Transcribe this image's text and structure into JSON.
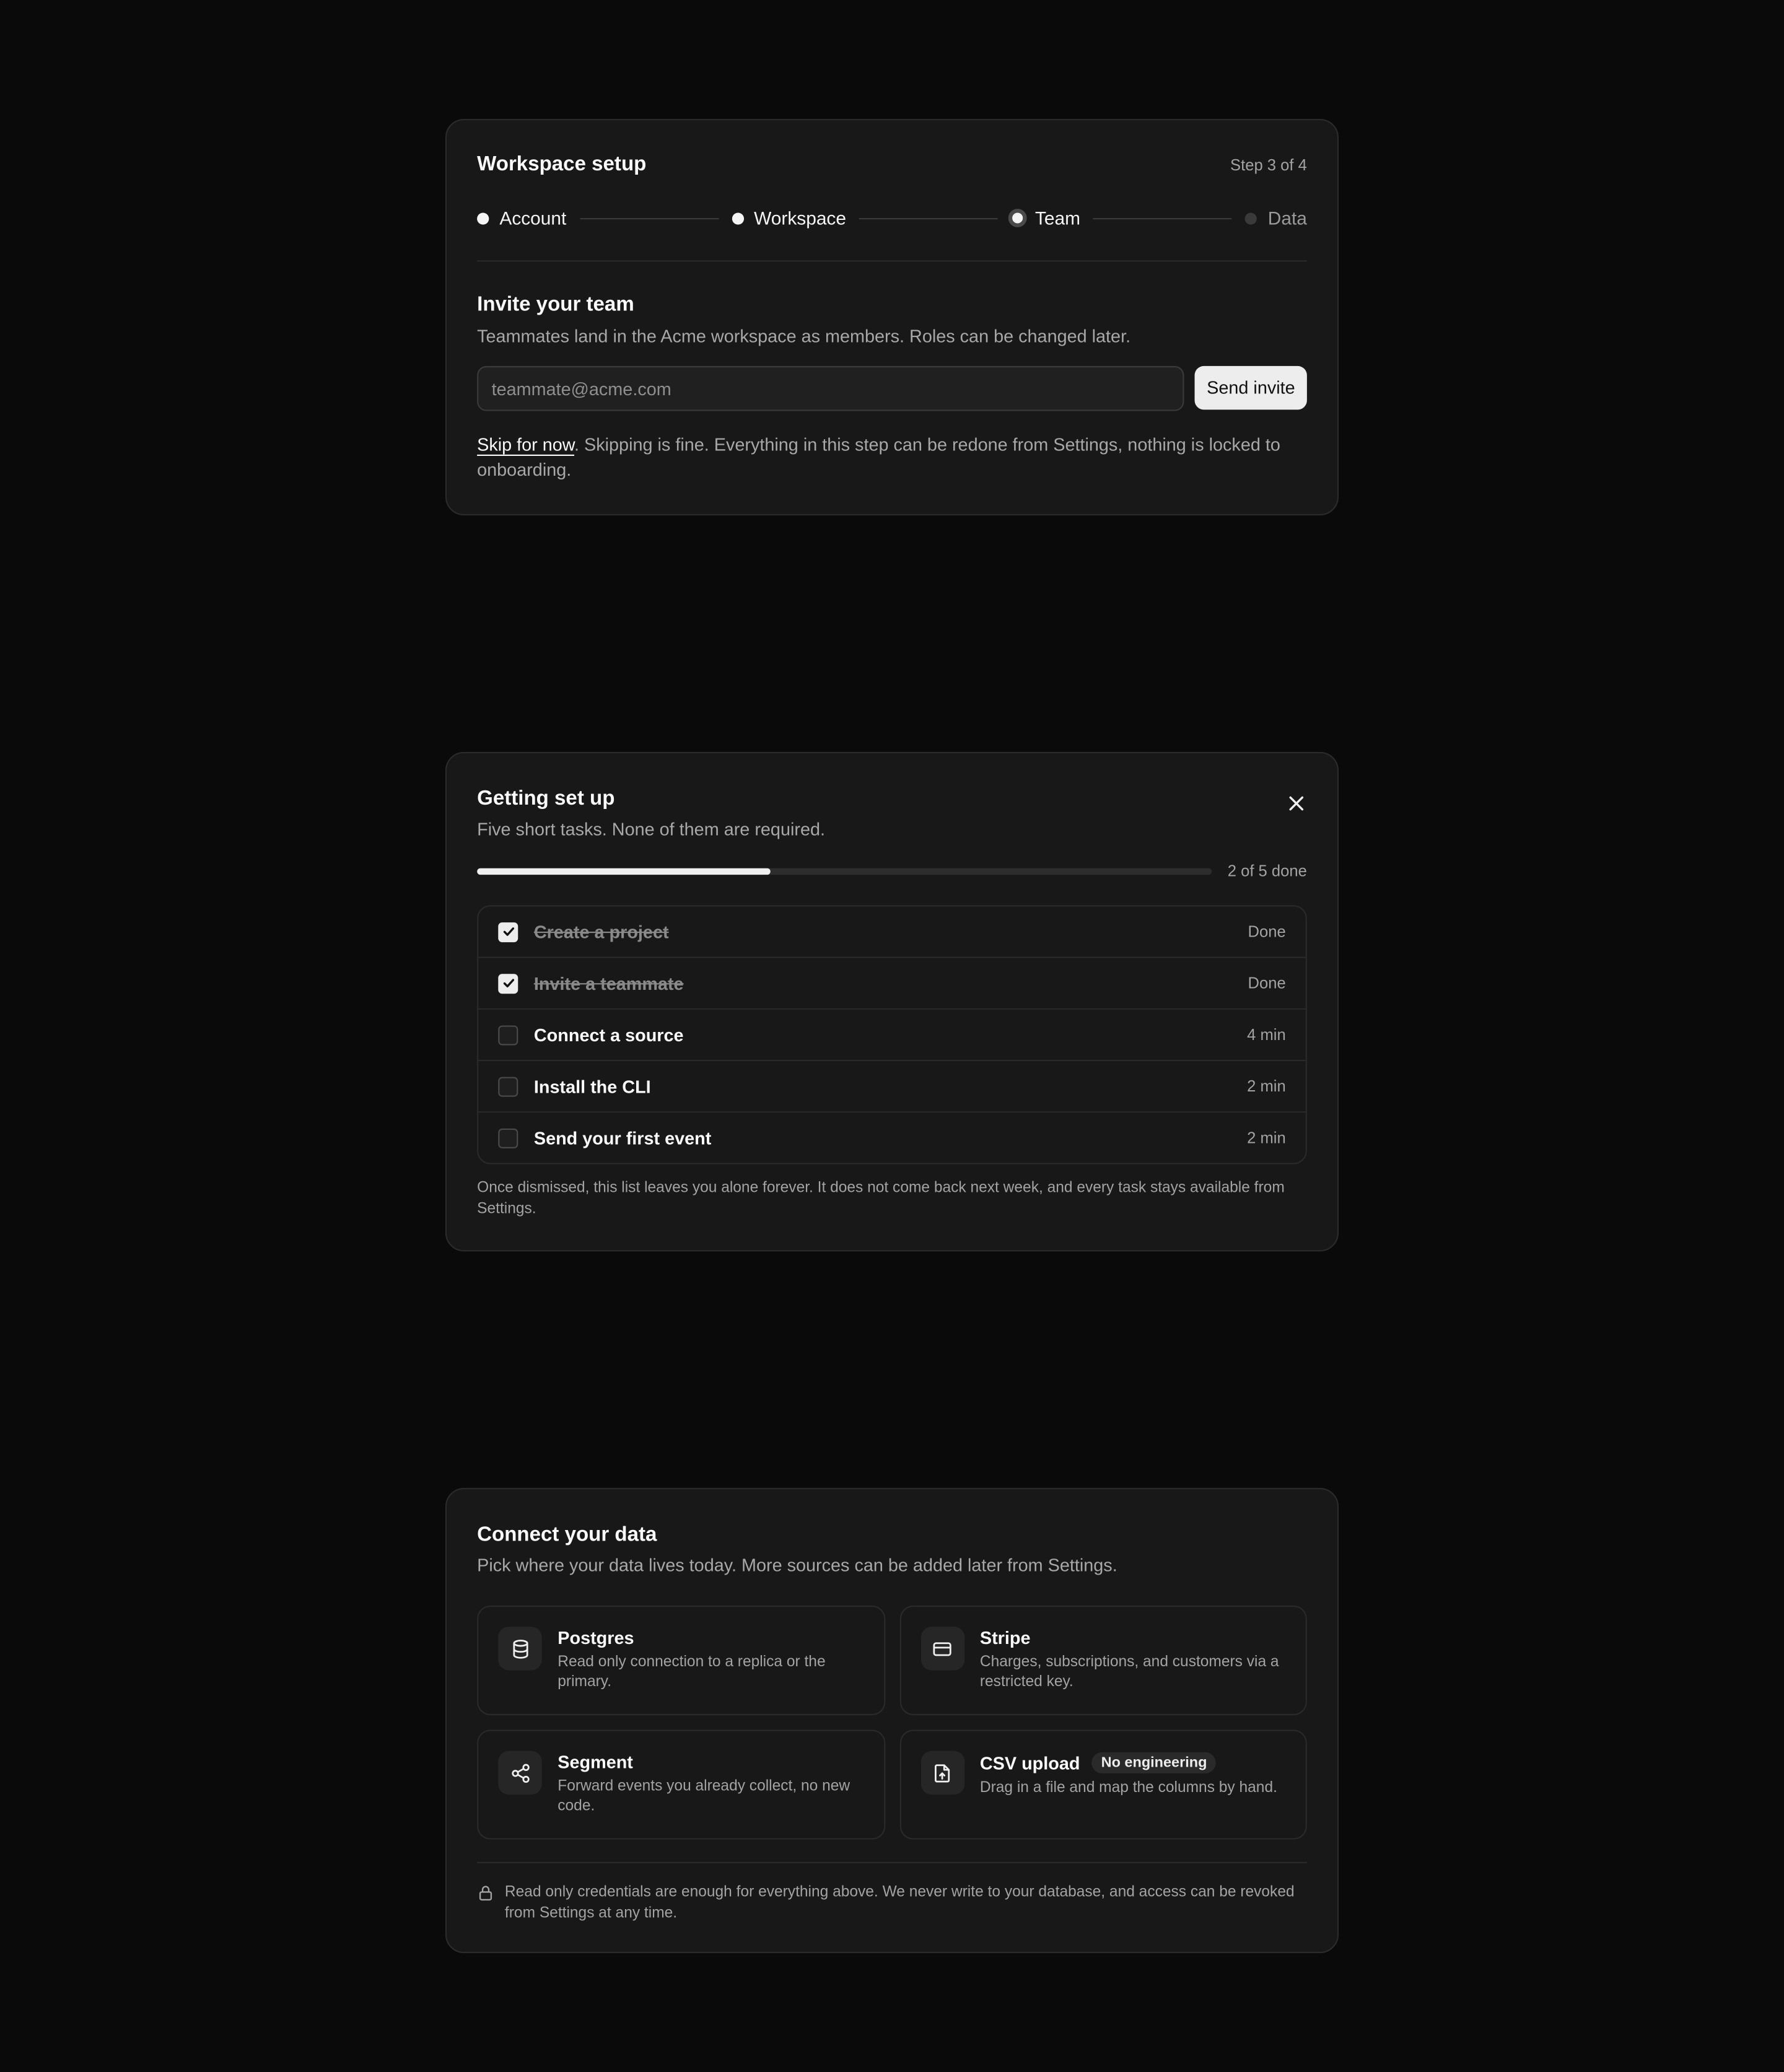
{
  "setup": {
    "title": "Workspace setup",
    "step_counter": "Step 3 of 4",
    "steps": [
      {
        "label": "Account",
        "state": "complete"
      },
      {
        "label": "Workspace",
        "state": "complete"
      },
      {
        "label": "Team",
        "state": "current"
      },
      {
        "label": "Data",
        "state": "upcoming"
      }
    ],
    "heading": "Invite your team",
    "subtext": "Teammates land in the Acme workspace as members. Roles can be changed later.",
    "email_placeholder": "teammate@acme.com",
    "send_label": "Send invite",
    "skip_link": "Skip for now",
    "skip_note": ". Skipping is fine. Everything in this step can be redone from Settings, nothing is locked to onboarding."
  },
  "getting_started": {
    "title": "Getting set up",
    "subtitle": "Five short tasks. None of them are required.",
    "progress": {
      "done": 2,
      "total": 5,
      "label": "2 of 5 done"
    },
    "tasks": [
      {
        "label": "Create a project",
        "meta": "Done",
        "done": true
      },
      {
        "label": "Invite a teammate",
        "meta": "Done",
        "done": true
      },
      {
        "label": "Connect a source",
        "meta": "4 min",
        "done": false
      },
      {
        "label": "Install the CLI",
        "meta": "2 min",
        "done": false
      },
      {
        "label": "Send your first event",
        "meta": "2 min",
        "done": false
      }
    ],
    "footnote": "Once dismissed, this list leaves you alone forever. It does not come back next week, and every task stays available from Settings."
  },
  "connect": {
    "title": "Connect your data",
    "subtitle": "Pick where your data lives today. More sources can be added later from Settings.",
    "sources": [
      {
        "icon": "database-icon",
        "name": "Postgres",
        "desc": "Read only connection to a replica or the primary."
      },
      {
        "icon": "credit-card-icon",
        "name": "Stripe",
        "desc": "Charges, subscriptions, and customers via a restricted key."
      },
      {
        "icon": "share-icon",
        "name": "Segment",
        "desc": "Forward events you already collect, no new code."
      },
      {
        "icon": "file-upload-icon",
        "name": "CSV upload",
        "badge": "No engineering",
        "desc": "Drag in a file and map the columns by hand."
      }
    ],
    "footnote": "Read only credentials are enough for everything above. We never write to your database, and access can be revoked from Settings at any time."
  },
  "colors": {
    "background": "#0a0a0a",
    "card": "#181818",
    "border": "#2b2b2b",
    "text": "#fafafa",
    "muted": "#a3a3a3"
  }
}
